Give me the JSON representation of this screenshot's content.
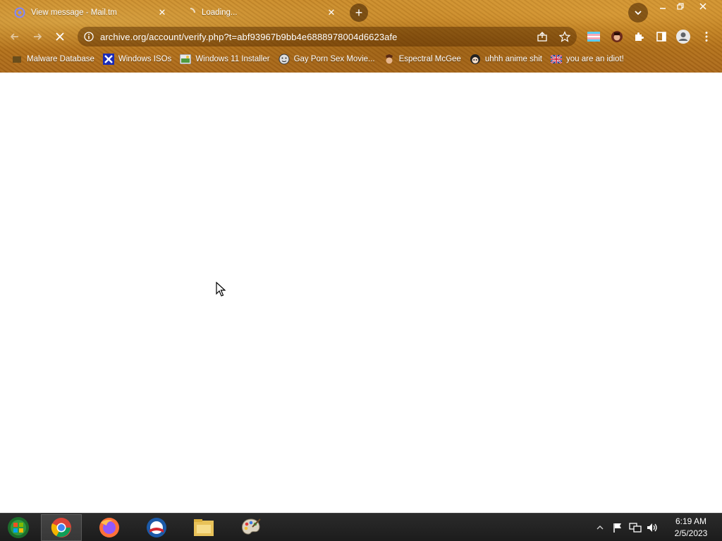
{
  "browser": {
    "tabs": [
      {
        "title": "View message - Mail.tm",
        "active": true,
        "favicon": "mailtm-icon"
      },
      {
        "title": "Loading...",
        "active": false,
        "favicon": "loading-spinner-icon"
      }
    ],
    "new_tab_label": "+",
    "address": {
      "url": "archive.org/account/verify.php?t=abf93967b9bb4e6888978004d6623afe"
    },
    "bookmarks": [
      {
        "label": "Malware Database",
        "icon": "folder-icon"
      },
      {
        "label": "Windows ISOs",
        "icon": "x-icon"
      },
      {
        "label": "Windows 11 Installer",
        "icon": "image-icon"
      },
      {
        "label": "Gay Porn Sex Movie...",
        "icon": "face-icon"
      },
      {
        "label": "Espectral McGee",
        "icon": "character-icon"
      },
      {
        "label": "uhhh anime shit",
        "icon": "anime-icon"
      },
      {
        "label": "you are an idiot!",
        "icon": "flag-icon"
      }
    ],
    "theme_colors": {
      "accent": "#b9771b",
      "omnibox": "#5a2d00"
    }
  },
  "taskbar": {
    "apps": [
      {
        "name": "chrome",
        "active": true
      },
      {
        "name": "firefox",
        "active": false
      },
      {
        "name": "edge-old",
        "active": false
      },
      {
        "name": "file-explorer",
        "active": false
      },
      {
        "name": "paint",
        "active": false
      }
    ],
    "clock": {
      "time": "6:19 AM",
      "date": "2/5/2023"
    }
  }
}
